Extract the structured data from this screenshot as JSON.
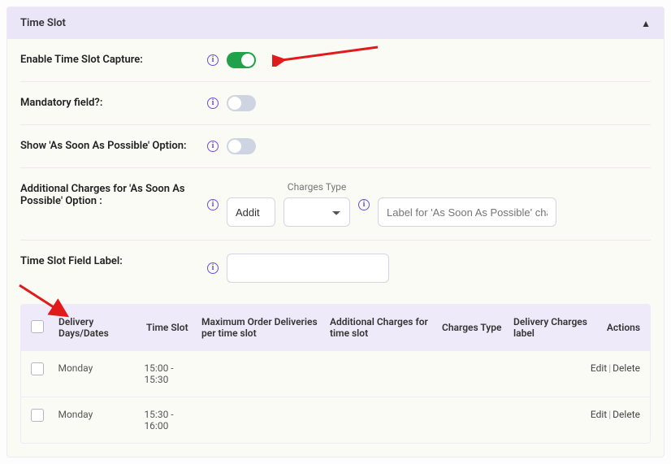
{
  "panel": {
    "title": "Time Slot"
  },
  "rows": {
    "enable": {
      "label": "Enable Time Slot Capture:"
    },
    "mandatory": {
      "label": "Mandatory field?:"
    },
    "asap": {
      "label": "Show 'As Soon As Possible' Option:"
    },
    "charges": {
      "label": "Additional Charges for 'As Soon As Possible' Option :",
      "amount_value": "Addit",
      "type_label": "Charges Type",
      "label_placeholder": "Label for 'As Soon As Possible' charges."
    },
    "fieldlabel": {
      "label": "Time Slot Field Label:"
    }
  },
  "table": {
    "headers": {
      "days": "Delivery Days/Dates",
      "slot": "Time Slot",
      "max": "Maximum Order Deliveries per time slot",
      "add": "Additional Charges for time slot",
      "ctype": "Charges Type",
      "dlabel": "Delivery Charges label",
      "actions": "Actions"
    },
    "rows": [
      {
        "days": "Monday",
        "slot": "15:00 - 15:30",
        "max": "",
        "add": "",
        "ctype": "",
        "dlabel": ""
      },
      {
        "days": "Monday",
        "slot": "15:30 - 16:00",
        "max": "",
        "add": "",
        "ctype": "",
        "dlabel": ""
      }
    ],
    "actions": {
      "edit": "Edit",
      "delete": "Delete"
    }
  },
  "colors": {
    "accent": "#6b4fd8",
    "toggle_on": "#1fa24a",
    "arrow": "#e11b1b"
  }
}
